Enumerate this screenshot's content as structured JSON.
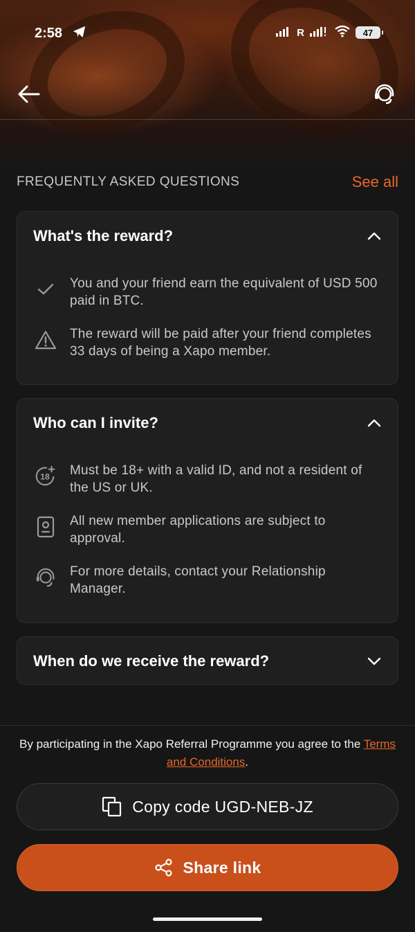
{
  "status_bar": {
    "time": "2:58",
    "carrier": "R",
    "battery": "47"
  },
  "faq": {
    "title": "FREQUENTLY ASKED QUESTIONS",
    "see_all": "See all",
    "sections": [
      {
        "question": "What's the reward?",
        "expanded": true,
        "items": [
          {
            "icon": "check-icon",
            "text": "You and your friend earn the equivalent of USD 500 paid in BTC."
          },
          {
            "icon": "warning-icon",
            "text": "The reward will be paid after your friend completes 33 days of being a Xapo member."
          }
        ]
      },
      {
        "question": "Who can I invite?",
        "expanded": true,
        "items": [
          {
            "icon": "age-18-plus-icon",
            "icon_text": "18",
            "text": "Must be 18+ with a valid ID, and not a resident of the US or UK."
          },
          {
            "icon": "id-card-icon",
            "text": "All new member applications are subject to approval."
          },
          {
            "icon": "support-agent-icon",
            "text": "For more details, contact your Relationship Manager."
          }
        ]
      },
      {
        "question": "When do we receive the reward?",
        "expanded": false
      }
    ]
  },
  "footer": {
    "terms_prefix": "By participating in the Xapo Referral Programme you agree to the ",
    "terms_link": "Terms and Conditions",
    "terms_suffix": ".",
    "copy_button": "Copy code UGD-NEB-JZ",
    "share_button": "Share link"
  },
  "colors": {
    "accent": "#e8672a",
    "share_button_bg": "#c9501b",
    "background": "#161616",
    "card_bg": "#1f1f1f"
  }
}
